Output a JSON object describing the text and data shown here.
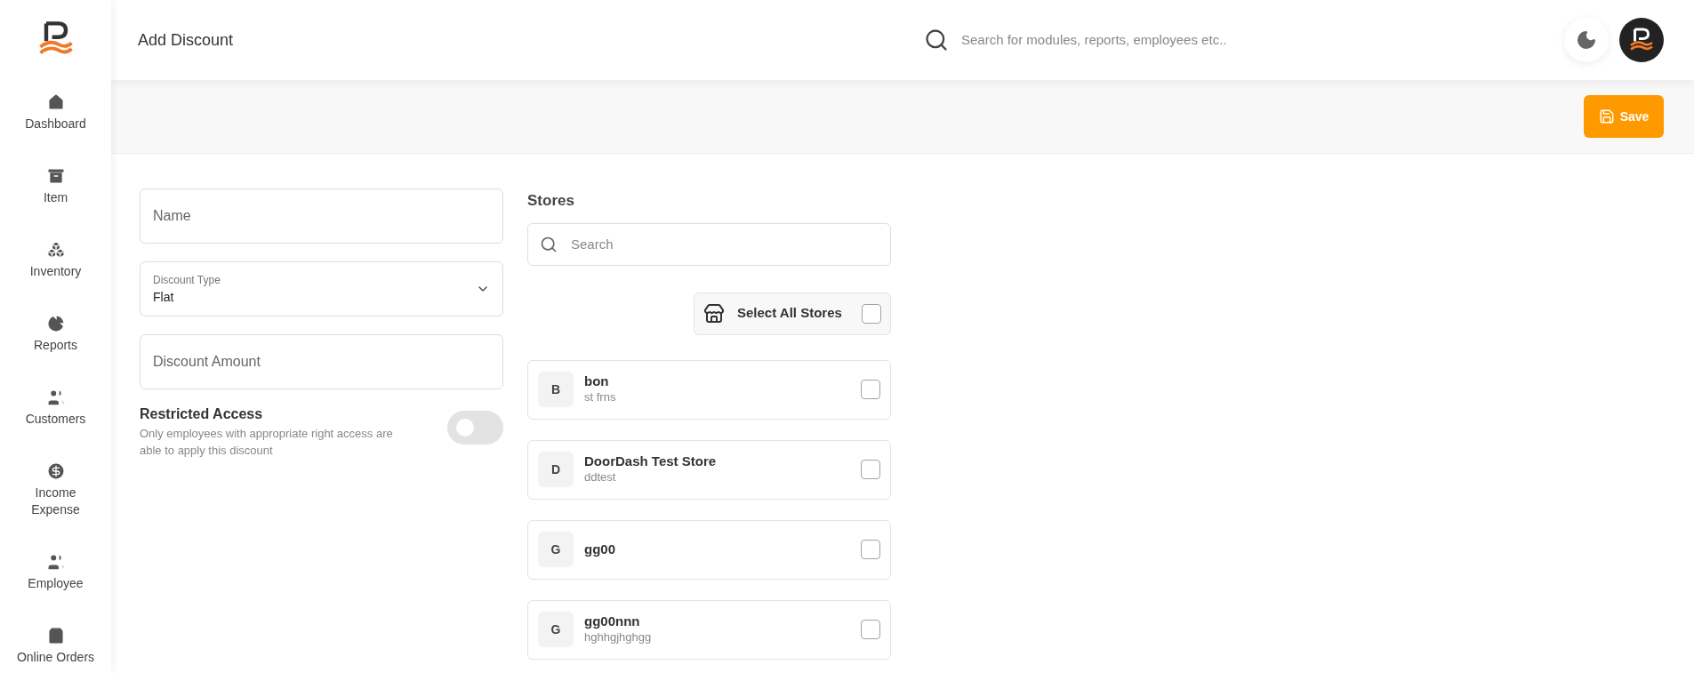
{
  "sidebar": {
    "items": [
      {
        "label": "Dashboard",
        "kind": "dashboard"
      },
      {
        "label": "Item",
        "kind": "item"
      },
      {
        "label": "Inventory",
        "kind": "inventory"
      },
      {
        "label": "Reports",
        "kind": "reports"
      },
      {
        "label": "Customers",
        "kind": "customers"
      },
      {
        "label": "Income Expense",
        "kind": "income"
      },
      {
        "label": "Employee",
        "kind": "employee"
      },
      {
        "label": "Online Orders",
        "kind": "orders"
      }
    ]
  },
  "header": {
    "title": "Add Discount",
    "search": {
      "placeholder": "Search for modules, reports, employees etc.."
    }
  },
  "toolbar": {
    "save_button": "Save"
  },
  "form": {
    "name": {
      "placeholder": "Name"
    },
    "discount_type": {
      "label": "Discount Type",
      "value": "Flat"
    },
    "discount_amount": {
      "placeholder": "Discount Amount"
    },
    "restricted_access": {
      "title": "Restricted Access",
      "description": "Only employees with appropriate right access are able to apply this discount",
      "on": false
    }
  },
  "stores": {
    "title": "Stores",
    "search": {
      "placeholder": "Search"
    },
    "select_all": {
      "label": "Select All Stores",
      "checked": false
    },
    "items": [
      {
        "initial": "B",
        "name": "bon",
        "subtitle": "st frns",
        "checked": false
      },
      {
        "initial": "D",
        "name": "DoorDash Test Store",
        "subtitle": "ddtest",
        "checked": false
      },
      {
        "initial": "G",
        "name": "gg00",
        "checked": false
      },
      {
        "initial": "G",
        "name": "gg00nnn",
        "subtitle": "hghhgjhghgg",
        "checked": false
      }
    ]
  }
}
